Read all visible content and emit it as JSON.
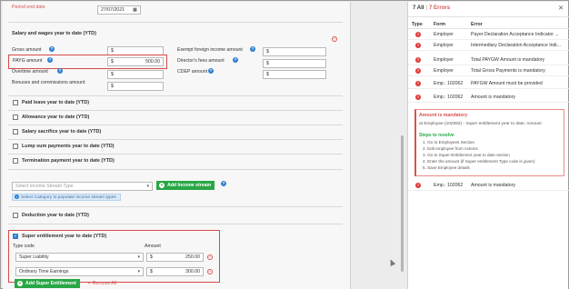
{
  "form": {
    "period_end_label": "Period end date",
    "period_end_value": "27/07/2021",
    "salary_section_title": "Salary and wages year to date (YTD)",
    "fields": {
      "gross_amount_label": "Gross amount",
      "gross_amount_value": "$",
      "payg_amount_label": "PAYG amount",
      "payg_amount_currency": "$",
      "payg_amount_value": "500.00",
      "overtime_amount_label": "Overtime amount",
      "overtime_amount_value": "$",
      "bonuses_label": "Bonuses and commissions amount",
      "bonuses_value": "$",
      "exempt_foreign_label": "Exempt foreign income amount",
      "exempt_foreign_value": "$",
      "directors_fees_label": "Director's fees amount",
      "directors_fees_value": "$",
      "cdep_label": "CDEP amount",
      "cdep_value": "$"
    },
    "checkbox_sections": [
      {
        "label": "Paid leave year to date (YTD)"
      },
      {
        "label": "Allowance year to date (YTD)"
      },
      {
        "label": "Salary sacrifice year to date (YTD)"
      },
      {
        "label": "Lump sum payments year to date (YTD)"
      },
      {
        "label": "Termination payment year to date (YTD)"
      }
    ],
    "income_stream": {
      "select_placeholder": "Select Income Stream Type",
      "add_button_label": "Add Income stream",
      "hint": "Select Category to populate income stream types"
    },
    "deduction_label": "Deduction year to date (YTD)",
    "super": {
      "title": "Super entitlement year to date (YTD)",
      "type_code_label": "Type code",
      "amount_label": "Amount",
      "rows": [
        {
          "type": "Super Liability",
          "currency": "$",
          "amount": "250.00"
        },
        {
          "type": "Ordinary Time Earnings",
          "currency": "$",
          "amount": "300.00"
        }
      ],
      "add_button_label": "Add Super Entitlement",
      "remove_all_label": "Remove All"
    }
  },
  "errors_panel": {
    "all_label": "7 All",
    "errors_label": "7 Errors",
    "columns": {
      "type": "Type",
      "form": "Form",
      "error": "Error"
    },
    "rows": [
      {
        "form": "Employer",
        "error": "Payer Declaration Acceptance Indicator ..."
      },
      {
        "form": "Employer",
        "error": "Intermediary Declaration Acceptance Indi..."
      },
      {
        "form": "Employer",
        "error": "Total PAYGW Amount is mandatory"
      },
      {
        "form": "Employer",
        "error": "Total Gross Payments is mandatory"
      },
      {
        "form": "Emp.: 102062",
        "error": "PAYGW Amount must be provided"
      },
      {
        "form": "Emp.: 102062",
        "error": "Amount is mandatory"
      }
    ],
    "detail": {
      "title": "Amount is mandatory",
      "location": "at Employee (102062) - Super entitlement year to date: Amount",
      "steps_title": "Steps to resolve",
      "steps": [
        "1. Go to Employees Section",
        "2. Edit employee from Actions",
        "3. Go to Super-Entitlement year to date section",
        "4. Enter the amount (if Super entitlement Type code is given)",
        "5. Save Employee details"
      ]
    },
    "last_row": {
      "form": "Emp.: 102062",
      "error": "Amount is mandatory"
    }
  },
  "colors": {
    "accent_blue": "#2f7fd1",
    "error_red": "#d9534f",
    "success_green": "#28a745"
  }
}
